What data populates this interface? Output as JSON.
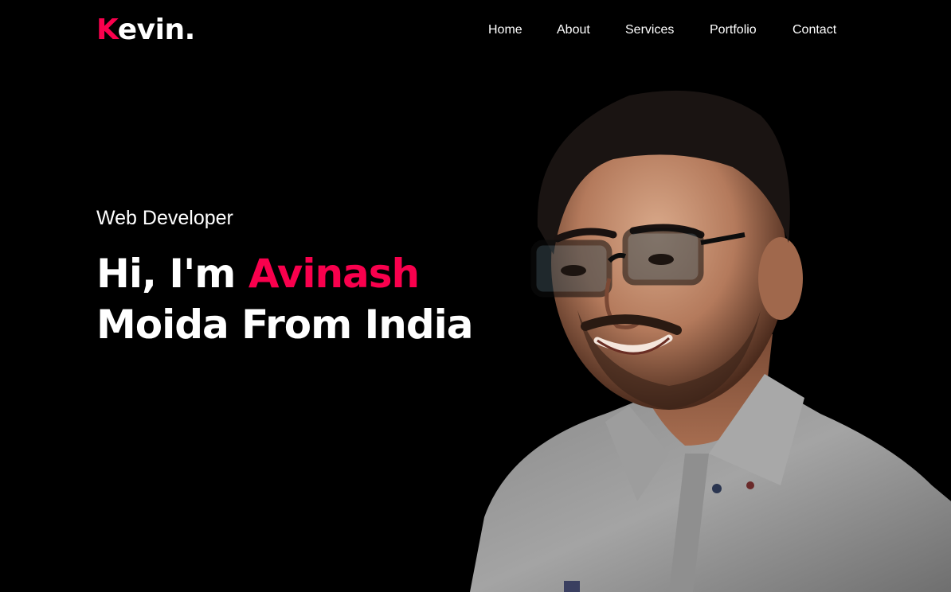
{
  "brand": {
    "logo_first_letter": "K",
    "logo_rest": "evin.",
    "accent_color": "#f9004d"
  },
  "nav": {
    "items": [
      "Home",
      "About",
      "Services",
      "Portfolio",
      "Contact"
    ]
  },
  "hero": {
    "subtitle": "Web Developer",
    "headline_prefix": "Hi, I'm ",
    "headline_highlight": "Avinash",
    "headline_line2": "Moida From India"
  },
  "colors": {
    "background": "#000000",
    "text": "#ffffff",
    "accent": "#f9004d"
  }
}
